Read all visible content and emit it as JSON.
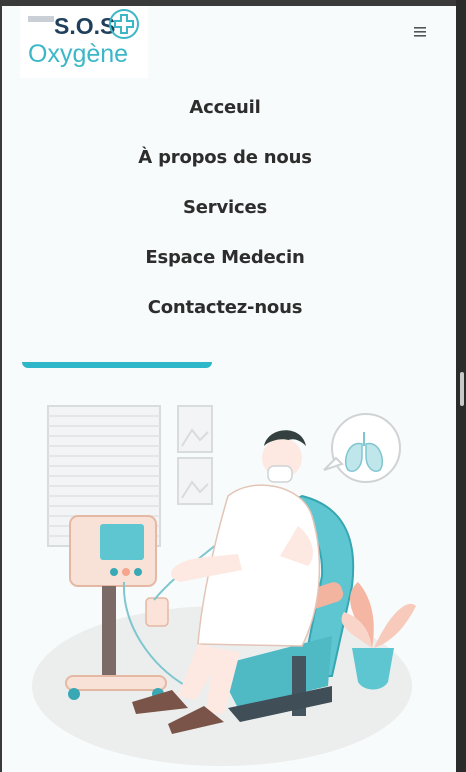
{
  "logo": {
    "text_top": "S.O.S",
    "text_bottom": "Oxygène",
    "brand_color": "#1f3f5b",
    "accent_color": "#3bb7c7"
  },
  "header": {
    "menu_icon": "hamburger-icon"
  },
  "nav": {
    "items": [
      {
        "label": "Acceuil"
      },
      {
        "label": "À propos de nous"
      },
      {
        "label": "Services"
      },
      {
        "label": "Espace Medecin"
      },
      {
        "label": "Contactez-nous"
      }
    ]
  },
  "colors": {
    "accent": "#2eb6c9",
    "text": "#2d2d2d",
    "background": "#f8fbfb"
  },
  "illustration": {
    "subject": "patient-on-oxygen-illustration"
  }
}
